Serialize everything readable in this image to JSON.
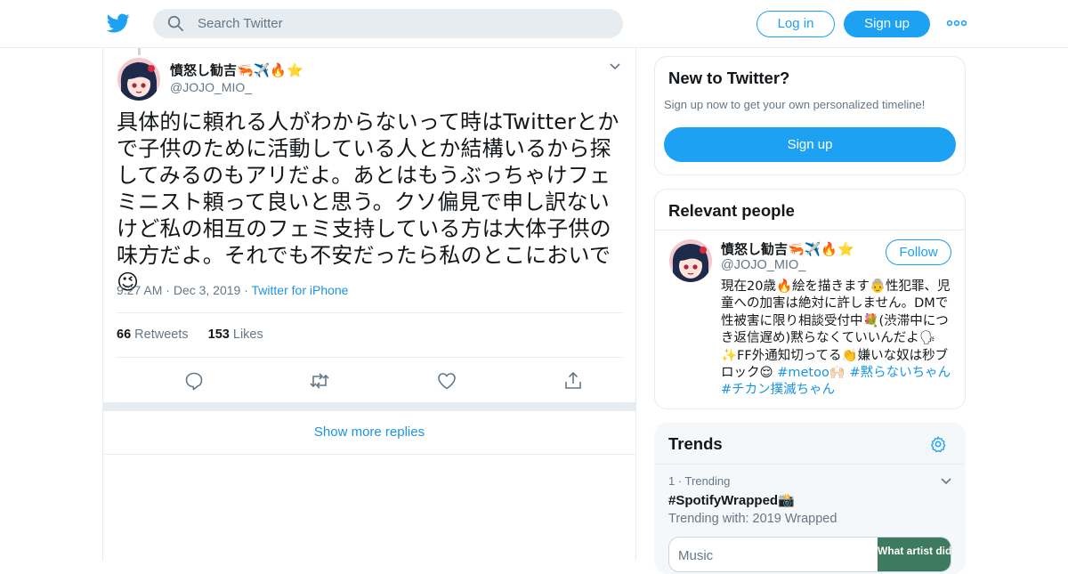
{
  "header": {
    "search_placeholder": "Search Twitter",
    "login_label": "Log in",
    "signup_label": "Sign up",
    "brand_color": "#1da1f2"
  },
  "tweet": {
    "display_name": "憤怒し勧吉🦐✈️🔥⭐",
    "handle": "@JOJO_MIO_",
    "text": "具体的に頼れる人がわからないって時はTwitterとかで子供のために活動している人とか結構いるから探してみるのもアリだよ。あとはもうぶっちゃけフェミニスト頼って良いと思う。クソ偏見で申し訳ないけど私の相互のフェミ支持している方は大体子供の味方だよ。それでも不安だったら私のとこにおいで😉",
    "time": "9:27 AM",
    "date": "Dec 3, 2019",
    "source": "Twitter for iPhone",
    "retweets_count": "66",
    "retweets_label": "Retweets",
    "likes_count": "153",
    "likes_label": "Likes",
    "actions": [
      "reply-icon",
      "retweet-icon",
      "like-icon",
      "share-icon"
    ]
  },
  "show_more_replies": "Show more replies",
  "sidebar": {
    "new_to_twitter": {
      "title": "New to Twitter?",
      "subtitle": "Sign up now to get your own personalized timeline!",
      "button": "Sign up"
    },
    "relevant_people": {
      "title": "Relevant people",
      "person": {
        "display_name": "憤怒し勧吉🦐✈️🔥⭐",
        "handle": "@JOJO_MIO_",
        "follow_label": "Follow",
        "bio_text": "現在20歳🔥絵を描きます👵性犯罪、児童への加害は絶対に許しません。DMで性被害に限り相談受付中💐(渋滞中につき返信遅め)黙らなくていいんだよ🗣✨FF外通知切ってる👏嫌いな奴は秒ブロック😌 ",
        "hashtags": [
          "#metoo",
          "#黙らないちゃん",
          "#チカン撲滅ちゃん"
        ],
        "hashtag_separator_emoji": "🙌🏻"
      }
    },
    "trends": {
      "title": "Trends",
      "item": {
        "rank_label": "1 · Trending",
        "name": "#SpotifyWrapped📸",
        "trending_with": "Trending with: 2019 Wrapped",
        "card_label": "Music",
        "card_thumb_text": "What artist did"
      }
    }
  }
}
